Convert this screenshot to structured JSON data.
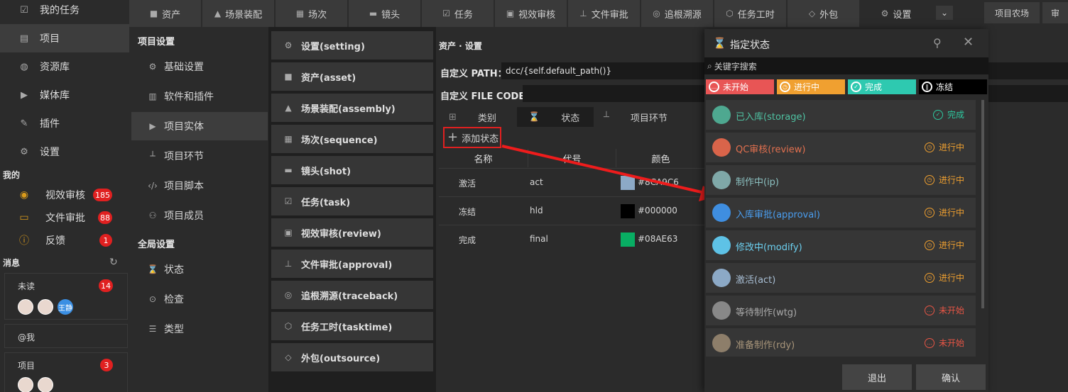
{
  "sidebar": {
    "nav": [
      {
        "label": "我的任务",
        "icon": "checkbox-icon"
      },
      {
        "label": "项目",
        "icon": "project-icon"
      },
      {
        "label": "资源库",
        "icon": "library-icon"
      },
      {
        "label": "媒体库",
        "icon": "media-icon"
      },
      {
        "label": "插件",
        "icon": "plugin-icon"
      },
      {
        "label": "设置",
        "icon": "gear-icon"
      }
    ],
    "my_title": "我的",
    "my_items": [
      {
        "label": "视效审核",
        "count": "185",
        "icon": "eye-icon"
      },
      {
        "label": "文件审批",
        "count": "88",
        "icon": "folder-icon"
      },
      {
        "label": "反馈",
        "count": "1",
        "icon": "info-icon"
      }
    ],
    "messages_title": "消息",
    "messages": [
      {
        "title": "未读",
        "count": "14",
        "avatar_text": "王静"
      },
      {
        "title": "@我"
      },
      {
        "title": "项目",
        "count": "3"
      }
    ]
  },
  "top_tabs": [
    {
      "label": "资产",
      "icon": "asset-icon"
    },
    {
      "label": "场景装配",
      "icon": "landscape-icon"
    },
    {
      "label": "场次",
      "icon": "sequence-icon"
    },
    {
      "label": "镜头",
      "icon": "clapper-icon"
    },
    {
      "label": "任务",
      "icon": "task-icon"
    },
    {
      "label": "视效审核",
      "icon": "video-icon"
    },
    {
      "label": "文件审批",
      "icon": "stamp-icon"
    },
    {
      "label": "追根溯源",
      "icon": "trace-icon"
    },
    {
      "label": "任务工时",
      "icon": "shield-icon"
    },
    {
      "label": "外包",
      "icon": "tag-icon"
    },
    {
      "label": "设置",
      "icon": "gear-icon"
    }
  ],
  "top_right": {
    "farm": "项目农场",
    "truncated": "审"
  },
  "settings": {
    "project_head": "项目设置",
    "project_items": [
      {
        "label": "基础设置",
        "icon": "gear-icon"
      },
      {
        "label": "软件和插件",
        "icon": "chart-icon"
      },
      {
        "label": "项目实体",
        "icon": "play-icon"
      },
      {
        "label": "项目环节",
        "icon": "node-icon"
      },
      {
        "label": "项目脚本",
        "icon": "code-icon"
      },
      {
        "label": "项目成员",
        "icon": "users-icon"
      }
    ],
    "global_head": "全局设置",
    "global_items": [
      {
        "label": "状态",
        "icon": "hourglass-icon"
      },
      {
        "label": "检查",
        "icon": "check-circle-icon"
      },
      {
        "label": "类型",
        "icon": "list-icon"
      }
    ]
  },
  "entities": [
    {
      "label": "设置(setting)",
      "icon": "gear-icon"
    },
    {
      "label": "资产(asset)",
      "icon": "asset-icon"
    },
    {
      "label": "场景装配(assembly)",
      "icon": "landscape-icon"
    },
    {
      "label": "场次(sequence)",
      "icon": "sequence-icon"
    },
    {
      "label": "镜头(shot)",
      "icon": "clapper-icon"
    },
    {
      "label": "任务(task)",
      "icon": "task-icon"
    },
    {
      "label": "视效审核(review)",
      "icon": "video-icon"
    },
    {
      "label": "文件审批(approval)",
      "icon": "stamp-icon"
    },
    {
      "label": "追根溯源(traceback)",
      "icon": "trace-icon"
    },
    {
      "label": "任务工时(tasktime)",
      "icon": "shield-icon"
    },
    {
      "label": "外包(outsource)",
      "icon": "tag-icon"
    }
  ],
  "main": {
    "breadcrumb": "资产 · 设置",
    "path_label": "自定义 PATH：",
    "path_value": "dcc/{self.default_path()}",
    "code_label": "自定义 FILE CODE:",
    "code_value": "",
    "sub_tabs": [
      {
        "label": "类别",
        "icon": "grid-icon"
      },
      {
        "label": "状态",
        "icon": "hourglass-icon"
      },
      {
        "label": "项目环节",
        "icon": "node-icon"
      }
    ],
    "add_status": "添加状态",
    "columns": [
      "名称",
      "代号",
      "颜色"
    ],
    "rows": [
      {
        "name": "激活",
        "code": "act",
        "color": "#8CA9C6",
        "color_text": "#8CA9C6"
      },
      {
        "name": "冻结",
        "code": "hld",
        "color": "#000000",
        "color_text": "#000000"
      },
      {
        "name": "完成",
        "code": "final",
        "color": "#08AE63",
        "color_text": "#08AE63"
      }
    ]
  },
  "dialog": {
    "title": "指定状态",
    "search_placeholder": "关键字搜索",
    "filters": [
      {
        "label": "未开始",
        "bg": "#e85555"
      },
      {
        "label": "进行中",
        "bg": "#f0a030"
      },
      {
        "label": "完成",
        "bg": "#2ec9b0"
      },
      {
        "label": "冻结",
        "bg": "#000000"
      }
    ],
    "statuses": [
      {
        "name": "已入库(storage)",
        "dot": "#4ea890",
        "color": "#4fc2a2",
        "tag": "完成",
        "tag_color": "#2ec9a0",
        "tag_icon": "✓"
      },
      {
        "name": "QC审核(review)",
        "dot": "#d9644a",
        "color": "#e2704f",
        "tag": "进行中",
        "tag_color": "#f0a030",
        "tag_icon": "◷"
      },
      {
        "name": "制作中(ip)",
        "dot": "#7fa8a8",
        "color": "#8cc0c0",
        "tag": "进行中",
        "tag_color": "#f0a030",
        "tag_icon": "◷"
      },
      {
        "name": "入库审批(approval)",
        "dot": "#3f8ee0",
        "color": "#4a9ef0",
        "tag": "进行中",
        "tag_color": "#f0a030",
        "tag_icon": "◷"
      },
      {
        "name": "修改中(modify)",
        "dot": "#5ec2e6",
        "color": "#6cd0f0",
        "tag": "进行中",
        "tag_color": "#f0a030",
        "tag_icon": "◷"
      },
      {
        "name": "激活(act)",
        "dot": "#8ca9c6",
        "color": "#a8bed4",
        "tag": "进行中",
        "tag_color": "#f0a030",
        "tag_icon": "◷"
      },
      {
        "name": "等待制作(wtg)",
        "dot": "#888888",
        "color": "#aaaaaa",
        "tag": "未开始",
        "tag_color": "#e85545",
        "tag_icon": "…"
      },
      {
        "name": "准备制作(rdy)",
        "dot": "#8d7e6a",
        "color": "#a8957a",
        "tag": "未开始",
        "tag_color": "#e85545",
        "tag_icon": "…"
      }
    ],
    "exit": "退出",
    "confirm": "确认"
  }
}
